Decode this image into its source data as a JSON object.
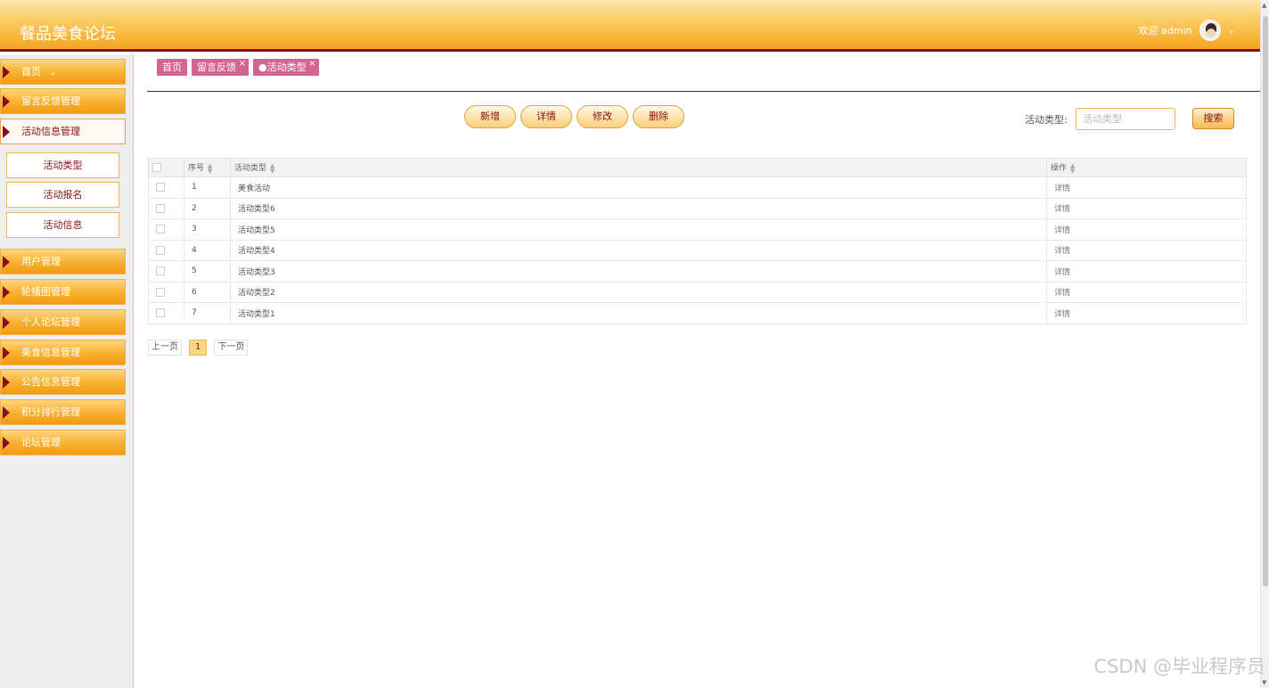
{
  "header": {
    "title": "餐品美食论坛",
    "welcome": "欢迎 admin"
  },
  "sidebar": {
    "items": [
      {
        "label": "首页",
        "expand": "⌄"
      },
      {
        "label": "留言反馈管理"
      },
      {
        "label": "活动信息管理",
        "active": true
      },
      {
        "label": "用户管理"
      },
      {
        "label": "轮播图管理"
      },
      {
        "label": "个人论坛管理"
      },
      {
        "label": "美食信息管理"
      },
      {
        "label": "公告信息管理"
      },
      {
        "label": "积分排行管理"
      },
      {
        "label": "论坛管理"
      }
    ],
    "sub_items": [
      "活动类型",
      "活动报名",
      "活动信息"
    ]
  },
  "tabs": [
    {
      "label": "首页"
    },
    {
      "label": "留言反馈",
      "close": "×"
    },
    {
      "label": "●活动类型",
      "close": "×"
    }
  ],
  "toolbar": {
    "add": "新增",
    "detail": "详情",
    "edit": "修改",
    "delete": "删除"
  },
  "search": {
    "label": "活动类型:",
    "placeholder": "活动类型",
    "button": "搜索"
  },
  "table": {
    "headers": [
      "序号",
      "活动类型",
      "操作"
    ],
    "rows": [
      {
        "no": "1",
        "type": "美食活动",
        "op": "详情"
      },
      {
        "no": "2",
        "type": "活动类型6",
        "op": "详情"
      },
      {
        "no": "3",
        "type": "活动类型5",
        "op": "详情"
      },
      {
        "no": "4",
        "type": "活动类型4",
        "op": "详情"
      },
      {
        "no": "5",
        "type": "活动类型3",
        "op": "详情"
      },
      {
        "no": "6",
        "type": "活动类型2",
        "op": "详情"
      },
      {
        "no": "7",
        "type": "活动类型1",
        "op": "详情"
      }
    ]
  },
  "pagination": {
    "prev": "上一页",
    "current": "1",
    "next": "下一页"
  },
  "watermark": "CSDN @毕业程序员",
  "icons": {
    "sort": "sort-arrows-icon",
    "close": "close-icon",
    "menu_arrow": "triangle-right-icon",
    "avatar": "user-avatar-icon"
  },
  "colors": {
    "accent": "#f7a51c",
    "dark_red": "#8a0f16",
    "tab_pink": "#d46493"
  }
}
